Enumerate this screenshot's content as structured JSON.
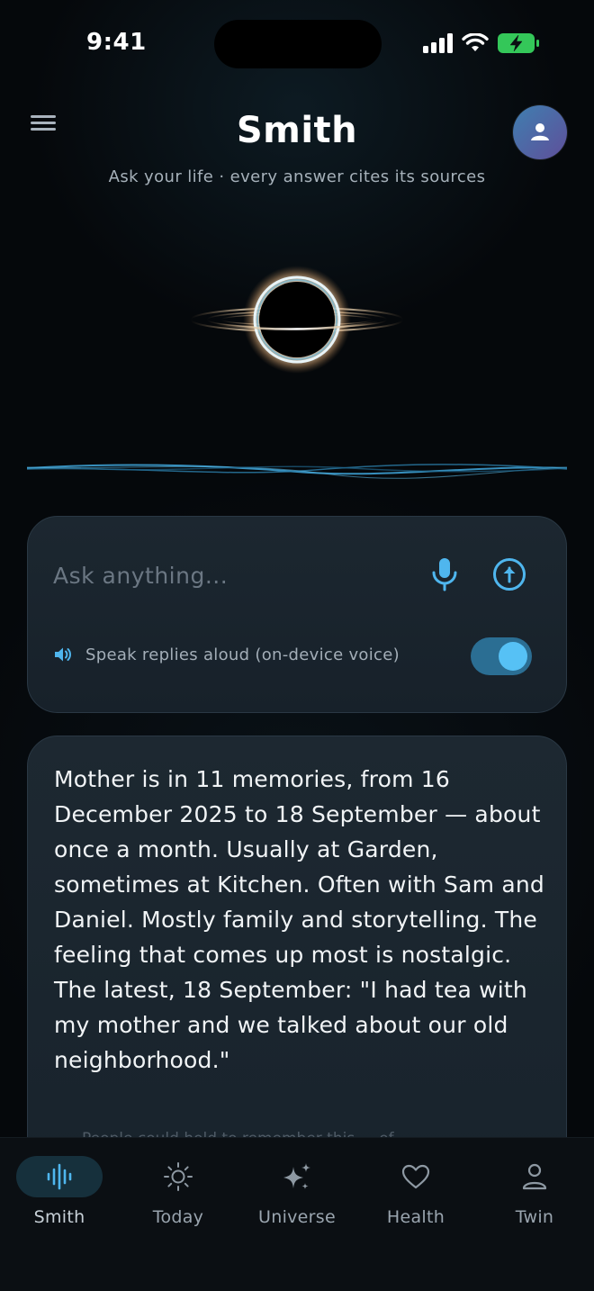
{
  "status_bar": {
    "time": "9:41"
  },
  "header": {
    "title": "Smith",
    "subtitle": "Ask your life · every answer cites its sources"
  },
  "input": {
    "placeholder": "Ask anything...",
    "value": "",
    "speak_label": "Speak replies aloud (on-device voice)",
    "speak_enabled": true
  },
  "answer": {
    "text": "Mother is in 11 memories, from 16 December 2025 to 18 September — about once a month. Usually at Garden, sometimes at Kitchen. Often with Sam and Daniel. Mostly family and storytelling. The feeling that comes up most is nostalgic. The latest, 18 September: \"I had tea with my mother and we talked about our old neighborhood.\"",
    "followup": "People could hold to remember this ... of"
  },
  "tabs": [
    {
      "label": "Smith",
      "icon": "waveform-icon",
      "active": true
    },
    {
      "label": "Today",
      "icon": "sun-icon",
      "active": false
    },
    {
      "label": "Universe",
      "icon": "sparkles-icon",
      "active": false
    },
    {
      "label": "Health",
      "icon": "heart-icon",
      "active": false
    },
    {
      "label": "Twin",
      "icon": "person-icon",
      "active": false
    }
  ],
  "colors": {
    "accent": "#4fb6ee",
    "toggle_on": "#2b6e93",
    "battery": "#34c759",
    "background": "#05080b",
    "card": "#1c2730"
  }
}
